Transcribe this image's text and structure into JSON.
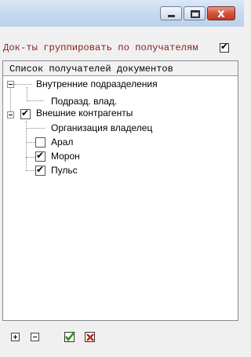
{
  "window": {
    "close_glyph": "x"
  },
  "options": {
    "group_by_recipient_label": "Док-ты группировать по получателям",
    "group_by_recipient_checked": true,
    "check_glyph": "✔"
  },
  "panel": {
    "header": "Список получателей документов"
  },
  "tree": {
    "internal": {
      "label": "Внутренние подразделения",
      "children": [
        "Подразд. влад."
      ]
    },
    "external": {
      "label": "Внешние контрагенты",
      "checked": true,
      "children": [
        {
          "label": "Организация владелец",
          "has_checkbox": false
        },
        {
          "label": "Арал",
          "checked": false
        },
        {
          "label": "Морон",
          "checked": true
        },
        {
          "label": "Пульс",
          "checked": true
        }
      ]
    }
  },
  "toolbar": {
    "items": [
      "expand-all",
      "collapse-all",
      "check-all",
      "uncheck-all"
    ],
    "colors": {
      "check_green": "#2f8a1f",
      "uncheck_red": "#c0201b"
    }
  }
}
